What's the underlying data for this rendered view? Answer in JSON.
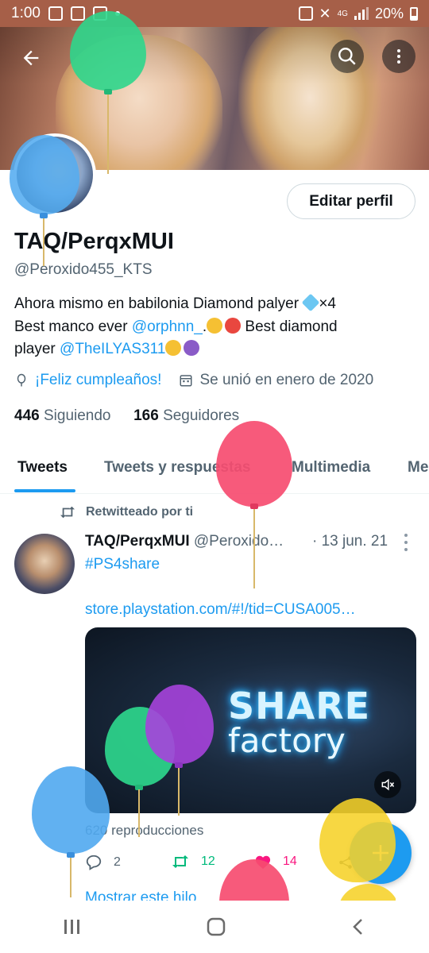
{
  "status_bar": {
    "time": "1:00",
    "network": "4G",
    "battery": "20%"
  },
  "profile": {
    "edit_label": "Editar perfil",
    "display_name": "TAQ/PerqxMUI",
    "handle": "@Peroxido455_KTS",
    "bio": {
      "line1_text": "Ahora mismo en babilonia Diamond palyer ",
      "line1_suffix": "×4",
      "line2_text": "Best manco ever ",
      "line2_mention": "@orphnn_",
      "line2_after": ".",
      "line2_tail": " Best diamond",
      "line3_text": "player ",
      "line3_mention": "@TheILYAS311"
    },
    "birthday": "¡Feliz cumpleaños!",
    "joined": "Se unió en enero de 2020",
    "following_count": "446",
    "following_label": "Siguiendo",
    "followers_count": "166",
    "followers_label": "Seguidores"
  },
  "tabs": [
    {
      "label": "Tweets",
      "active": true
    },
    {
      "label": "Tweets y respuestas",
      "active": false
    },
    {
      "label": "Multimedia",
      "active": false
    },
    {
      "label": "Me",
      "active": false
    }
  ],
  "tweet": {
    "retweet_label": "Retwitteado por ti",
    "author_name": "TAQ/PerqxMUI",
    "author_handle": "@Peroxido…",
    "date": "· 13 jun. 21",
    "hashtag": "#PS4share",
    "url": "store.playstation.com/#!/tid=CUSA005…",
    "media_title": "SHARE",
    "media_subtitle": "factory",
    "views": "620 reproducciones",
    "reply_count": "2",
    "retweet_count": "12",
    "like_count": "14",
    "show_thread": "Mostrar este hilo"
  },
  "colors": {
    "accent": "#1d9bf0",
    "retweet": "#00ba7c",
    "like": "#f91880",
    "status_bar": "#a65f48"
  },
  "icons": [
    "back-arrow-icon",
    "search-icon",
    "more-vertical-icon",
    "balloon-icon",
    "calendar-icon",
    "retweet-icon",
    "reply-icon",
    "heart-icon",
    "share-icon",
    "mute-icon",
    "compose-plus-icon",
    "recent-apps-icon",
    "home-icon",
    "nav-back-icon"
  ]
}
